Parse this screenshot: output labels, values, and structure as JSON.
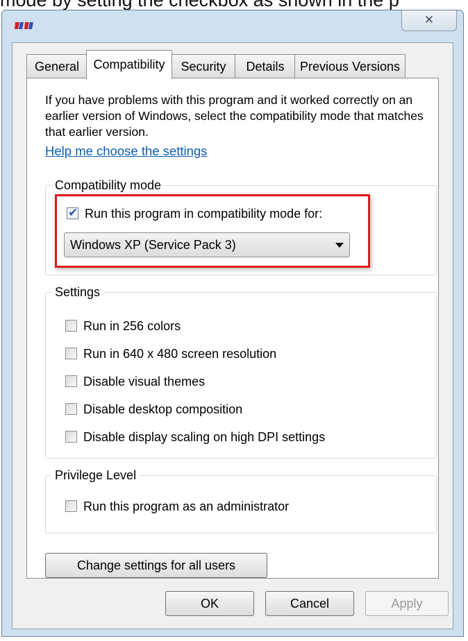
{
  "caption": "mode by setting the checkbox as shown in the p",
  "window": {
    "icon": "app-icon",
    "close_label": "✕",
    "tabs": [
      {
        "label": "General",
        "active": false
      },
      {
        "label": "Compatibility",
        "active": true
      },
      {
        "label": "Security",
        "active": false
      },
      {
        "label": "Details",
        "active": false
      },
      {
        "label": "Previous Versions",
        "active": false
      }
    ]
  },
  "compat": {
    "intro": "If you have problems with this program and it worked correctly on an earlier version of Windows, select the compatibility mode that matches that earlier version.",
    "help_link": "Help me choose the settings",
    "mode_group_title": "Compatibility mode",
    "mode_checkbox_label": "Run this program in compatibility mode for:",
    "mode_checked": true,
    "mode_selected": "Windows XP (Service Pack 3)",
    "settings_group_title": "Settings",
    "settings": [
      {
        "label": "Run in 256 colors",
        "checked": false
      },
      {
        "label": "Run in 640 x 480 screen resolution",
        "checked": false
      },
      {
        "label": "Disable visual themes",
        "checked": false
      },
      {
        "label": "Disable desktop composition",
        "checked": false
      },
      {
        "label": "Disable display scaling on high DPI settings",
        "checked": false
      }
    ],
    "privilege_group_title": "Privilege Level",
    "admin_label": "Run this program as an administrator",
    "admin_checked": false,
    "change_all_button": "Change settings for all users"
  },
  "buttons": {
    "ok": "OK",
    "cancel": "Cancel",
    "apply": "Apply"
  },
  "colors": {
    "highlight": "#e0161d",
    "link": "#0a5fb4",
    "frame": "#cfe0f1"
  }
}
